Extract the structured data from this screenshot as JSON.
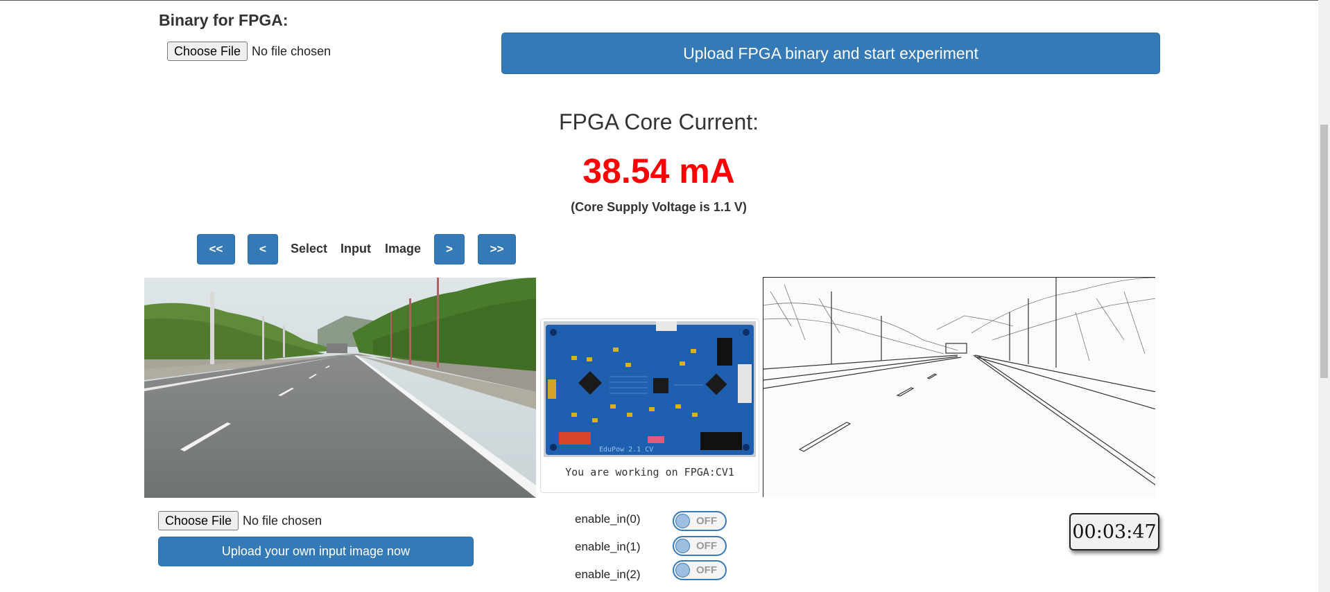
{
  "fpga_upload": {
    "title": "Binary for FPGA:",
    "choose_file_label": "Choose File",
    "file_status": "No file chosen",
    "upload_button": "Upload FPGA binary and start experiment"
  },
  "core_current": {
    "heading": "FPGA Core Current:",
    "value": "38.54 mA",
    "note": "(Core Supply Voltage is 1.1 V)"
  },
  "image_nav": {
    "first_label": "<<",
    "prev_label": "<",
    "words": [
      "Select",
      "Input",
      "Image"
    ],
    "next_label": ">",
    "last_label": ">>"
  },
  "board": {
    "caption": "You are working on FPGA:CV1",
    "silkscreen": "EduPow 2.1 CV"
  },
  "image_upload": {
    "choose_file_label": "Choose File",
    "file_status": "No file chosen",
    "upload_button": "Upload your own input image now"
  },
  "toggles": [
    {
      "label": "enable_in(0)",
      "state": "OFF"
    },
    {
      "label": "enable_in(1)",
      "state": "OFF"
    },
    {
      "label": "enable_in(2)",
      "state": "OFF"
    }
  ],
  "timer": "00:03:47",
  "colors": {
    "primary": "#337ab7",
    "current_value": "#ff0000",
    "board_pcb": "#1f5fb0"
  }
}
